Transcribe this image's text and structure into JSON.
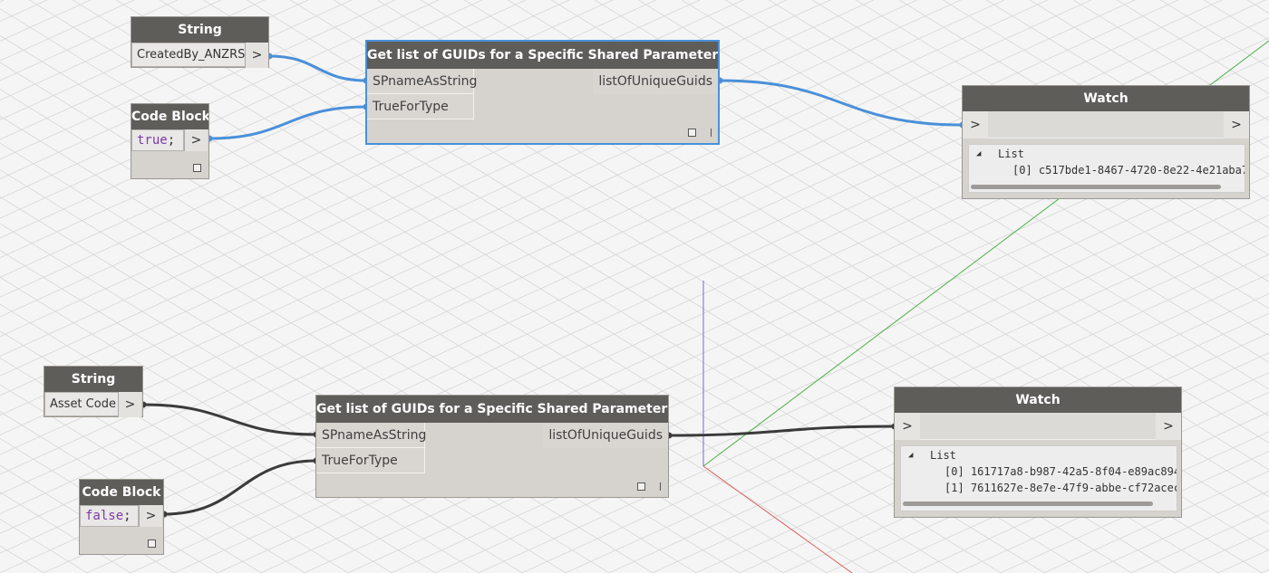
{
  "canvas": {
    "background": "#f5f5f5",
    "grid_color": "#d6d6d6",
    "axis_colors": {
      "x": "#e05a5a",
      "y": "#4caf50",
      "z": "#6b6bd6"
    }
  },
  "wire_colors": {
    "selected": "#4a90d9",
    "normal": "#3a3a3a"
  },
  "top_group": {
    "string_node": {
      "title": "String",
      "value": "CreatedBy_ANZRS",
      "out_label": ">"
    },
    "code_block": {
      "title": "Code Block",
      "keyword": "true",
      "suffix": ";",
      "out_label": ">"
    },
    "function_node": {
      "title": "Get list of GUIDs for a Specific Shared Parameter Name",
      "inputs": [
        "SPnameAsString",
        "TrueForType"
      ],
      "output": "listOfUniqueGuids"
    },
    "watch": {
      "title": "Watch",
      "in_label": ">",
      "out_label": ">",
      "tree_toggle": "◢",
      "root_label": "List",
      "items": [
        "[0] c517bde1-8467-4720-8e22-4e21aba7"
      ]
    }
  },
  "bottom_group": {
    "string_node": {
      "title": "String",
      "value": "Asset Code",
      "out_label": ">"
    },
    "code_block": {
      "title": "Code Block",
      "keyword": "false",
      "suffix": ";",
      "out_label": ">"
    },
    "function_node": {
      "title": "Get list of GUIDs for a Specific Shared Parameter Name",
      "inputs": [
        "SPnameAsString",
        "TrueForType"
      ],
      "output": "listOfUniqueGuids"
    },
    "watch": {
      "title": "Watch",
      "in_label": ">",
      "out_label": ">",
      "tree_toggle": "◢",
      "root_label": "List",
      "items": [
        "[0] 161717a8-b987-42a5-8f04-e89ac894",
        "[1] 7611627e-8e7e-47f9-abbe-cf72acec"
      ]
    }
  }
}
